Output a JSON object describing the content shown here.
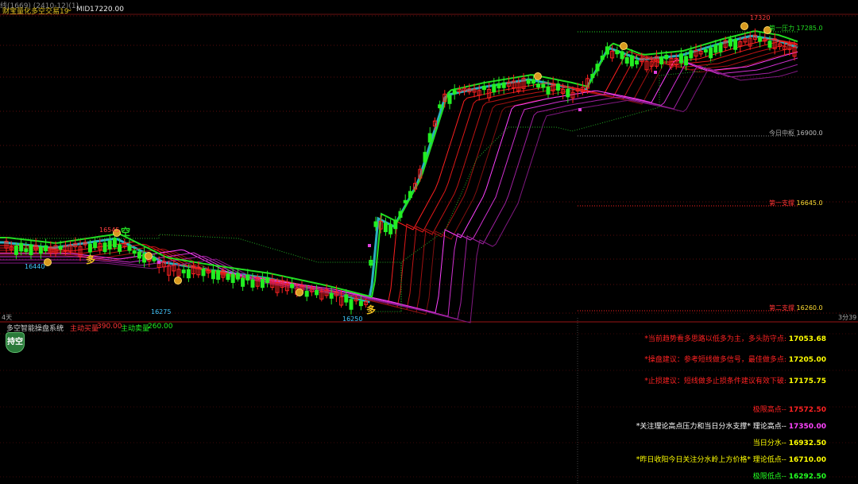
{
  "top_left_fragment": "线(1669) (2410-12)(1)",
  "indicator_title": "财宝量化多空交易19",
  "mid_label": "MID",
  "mid_value": "17220.00",
  "price_labels": {
    "high": "17320",
    "high_left": "16545",
    "low_left": "16440",
    "low_mid": "16275",
    "low_bottom": "16250"
  },
  "levels": [
    {
      "label": "第一压力",
      "value": "17285.0",
      "color": "#22dd22"
    },
    {
      "label": "今日中枢",
      "value": "16900.0",
      "color": "#cccccc"
    },
    {
      "label": "第一支撑",
      "value": "16645.0",
      "color": "#ff3333"
    },
    {
      "label": "第二支撑",
      "value": "16260.0",
      "color": "#ff3333"
    }
  ],
  "signals": {
    "long": "多",
    "short": "空"
  },
  "time_labels": {
    "left": "4天",
    "right": "3分39"
  },
  "lower_panel": {
    "title": "多空智能操盘系统",
    "active_buy_label": "主动买量",
    "active_buy_value": "390.00",
    "active_sell_label": "主动卖量",
    "active_sell_value": "260.00",
    "status_badge": "持空"
  },
  "info_lines": [
    {
      "text": "*当前趋势看多思路以低多为主，多头防守点:",
      "value": "17053.68",
      "text_color": "#ff2222",
      "value_color": "#ffff00"
    },
    {
      "text": "*操盘建议：参考短线做多信号，最佳做多点:",
      "value": "17205.00",
      "text_color": "#ff2222",
      "value_color": "#ffff00"
    },
    {
      "text": "*止损建议：短线做多止损条件建议有效下破:",
      "value": "17175.75",
      "text_color": "#ff2222",
      "value_color": "#ffff00"
    },
    {
      "text": "极限高点--",
      "value": "17572.50",
      "text_color": "#ff2222",
      "value_color": "#ff2222"
    },
    {
      "text": "*关注理论高点压力和当日分水支撑*  理论高点--",
      "value": "17350.00",
      "text_color": "#ffffff",
      "value_color": "#ff44ff"
    },
    {
      "text": "当日分水--",
      "value": "16932.50",
      "text_color": "#ffff00",
      "value_color": "#ffff00"
    },
    {
      "text": "*昨日收阳今日关注分水岭上方价格*  理论低点--",
      "value": "16710.00",
      "text_color": "#ffff00",
      "value_color": "#ffff00"
    },
    {
      "text": "极限低点--",
      "value": "16292.50",
      "text_color": "#22ff22",
      "value_color": "#22ff22"
    }
  ],
  "colors": {
    "up": "#ff2222",
    "down": "#22ee22",
    "background": "#000000",
    "grid": "#8a1010"
  }
}
